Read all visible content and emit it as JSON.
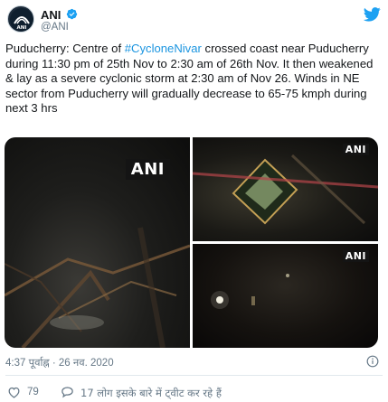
{
  "author": {
    "name": "ANI",
    "handle": "@ANI",
    "avatar_text": "ANI"
  },
  "tweet": {
    "text_before": "Puducherry: Centre of ",
    "hashtag": "#CycloneNivar",
    "text_after": " crossed coast near Puducherry during 11:30 pm of 25th Nov to 2:30 am of 26th Nov. It then weakened & lay as a severe cyclonic storm at 2:30 am of Nov 26. Winds in NE sector from Puducherry will gradually decrease to 65-75 kmph during next 3 hrs"
  },
  "media": [
    {
      "badge": "ANI"
    },
    {
      "badge": "ANI"
    },
    {
      "badge": "ANI"
    }
  ],
  "timestamp": "4:37 पूर्वाह्न · 26 नव. 2020",
  "stats": {
    "likes": "79",
    "conversation": "17 लोग इसके बारे में ट्वीट कर रहे हैं"
  },
  "colors": {
    "link": "#1b95e0",
    "muted": "#657786",
    "like": "#e0245e",
    "brand": "#1da1f2"
  },
  "icons": [
    "verified-icon",
    "twitter-icon",
    "info-icon",
    "heart-icon",
    "comment-icon"
  ]
}
